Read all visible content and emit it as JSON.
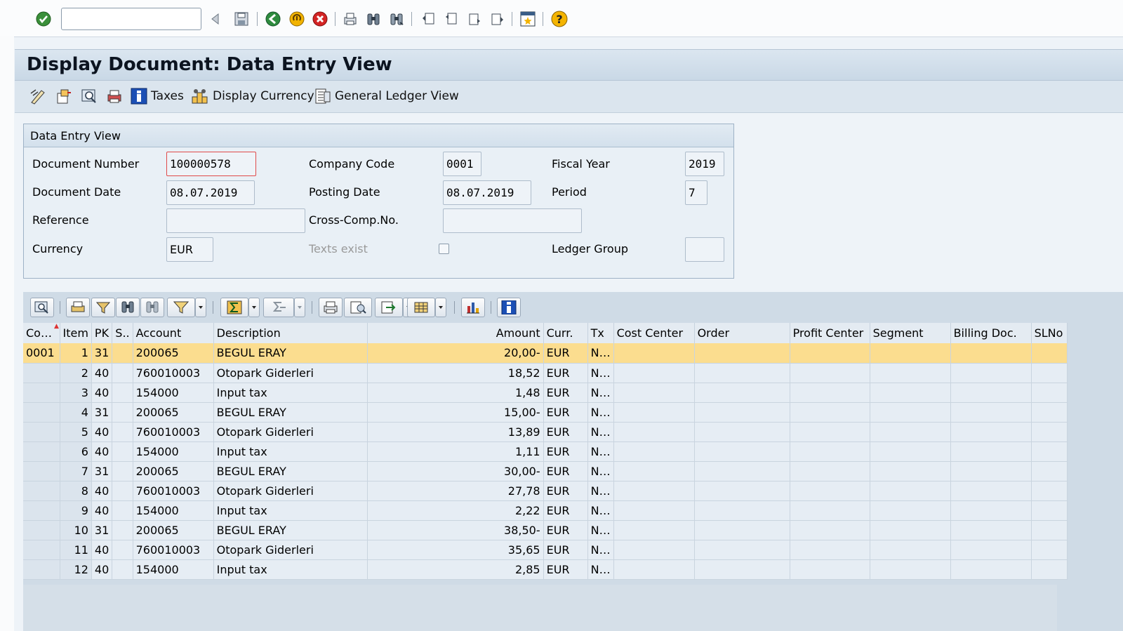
{
  "system_toolbar": {
    "command_field": {
      "value": "",
      "placeholder": ""
    },
    "icons": [
      "enter-icon",
      "back-arrow-icon",
      "save-icon",
      "back-icon",
      "exit-icon",
      "cancel-icon",
      "print-icon",
      "find-icon",
      "find-next-icon",
      "first-page-icon",
      "previous-page-icon",
      "next-page-icon",
      "last-page-icon",
      "create-session-icon",
      "help-icon"
    ]
  },
  "title": "Display Document: Data Entry View",
  "app_toolbar": {
    "taxes_label": "Taxes",
    "display_currency_label": "Display Currency",
    "general_ledger_view_label": "General Ledger View"
  },
  "header": {
    "group_title": "Data Entry View",
    "document_number_label": "Document Number",
    "document_number": "100000578",
    "company_code_label": "Company Code",
    "company_code": "0001",
    "fiscal_year_label": "Fiscal Year",
    "fiscal_year": "2019",
    "document_date_label": "Document Date",
    "document_date": "08.07.2019",
    "posting_date_label": "Posting Date",
    "posting_date": "08.07.2019",
    "period_label": "Period",
    "period": "7",
    "reference_label": "Reference",
    "reference": "",
    "cross_comp_label": "Cross-Comp.No.",
    "cross_comp": "",
    "currency_label": "Currency",
    "currency": "EUR",
    "texts_exist_label": "Texts exist",
    "texts_exist_checked": false,
    "ledger_group_label": "Ledger Group",
    "ledger_group": ""
  },
  "grid": {
    "columns": [
      "Co…",
      "Item",
      "PK",
      "S..",
      "Account",
      "Description",
      "Amount",
      "Curr.",
      "Tx",
      "Cost Center",
      "Order",
      "Profit Center",
      "Segment",
      "Billing Doc.",
      "SLNo"
    ],
    "rows": [
      {
        "co": "0001",
        "item": "1",
        "pk": "31",
        "s": "",
        "account": "200065",
        "description": "BEGUL ERAY",
        "amount": "20,00-",
        "curr": "EUR",
        "tx": "N…",
        "selected": true
      },
      {
        "co": "",
        "item": "2",
        "pk": "40",
        "s": "",
        "account": "760010003",
        "description": "Otopark Giderleri",
        "amount": "18,52",
        "curr": "EUR",
        "tx": "N…",
        "selected": false
      },
      {
        "co": "",
        "item": "3",
        "pk": "40",
        "s": "",
        "account": "154000",
        "description": "Input tax",
        "amount": "1,48",
        "curr": "EUR",
        "tx": "N…",
        "selected": false
      },
      {
        "co": "",
        "item": "4",
        "pk": "31",
        "s": "",
        "account": "200065",
        "description": "BEGUL ERAY",
        "amount": "15,00-",
        "curr": "EUR",
        "tx": "N…",
        "selected": false
      },
      {
        "co": "",
        "item": "5",
        "pk": "40",
        "s": "",
        "account": "760010003",
        "description": "Otopark Giderleri",
        "amount": "13,89",
        "curr": "EUR",
        "tx": "N…",
        "selected": false
      },
      {
        "co": "",
        "item": "6",
        "pk": "40",
        "s": "",
        "account": "154000",
        "description": "Input tax",
        "amount": "1,11",
        "curr": "EUR",
        "tx": "N…",
        "selected": false
      },
      {
        "co": "",
        "item": "7",
        "pk": "31",
        "s": "",
        "account": "200065",
        "description": "BEGUL ERAY",
        "amount": "30,00-",
        "curr": "EUR",
        "tx": "N…",
        "selected": false
      },
      {
        "co": "",
        "item": "8",
        "pk": "40",
        "s": "",
        "account": "760010003",
        "description": "Otopark Giderleri",
        "amount": "27,78",
        "curr": "EUR",
        "tx": "N…",
        "selected": false
      },
      {
        "co": "",
        "item": "9",
        "pk": "40",
        "s": "",
        "account": "154000",
        "description": "Input tax",
        "amount": "2,22",
        "curr": "EUR",
        "tx": "N…",
        "selected": false
      },
      {
        "co": "",
        "item": "10",
        "pk": "31",
        "s": "",
        "account": "200065",
        "description": "BEGUL ERAY",
        "amount": "38,50-",
        "curr": "EUR",
        "tx": "N…",
        "selected": false
      },
      {
        "co": "",
        "item": "11",
        "pk": "40",
        "s": "",
        "account": "760010003",
        "description": "Otopark Giderleri",
        "amount": "35,65",
        "curr": "EUR",
        "tx": "N…",
        "selected": false
      },
      {
        "co": "",
        "item": "12",
        "pk": "40",
        "s": "",
        "account": "154000",
        "description": "Input tax",
        "amount": "2,85",
        "curr": "EUR",
        "tx": "N…",
        "selected": false
      }
    ]
  },
  "colors": {
    "selected_row": "#fbdd8f",
    "title_bar": "#c9d8e6",
    "focus_border": "#e04a4a"
  }
}
